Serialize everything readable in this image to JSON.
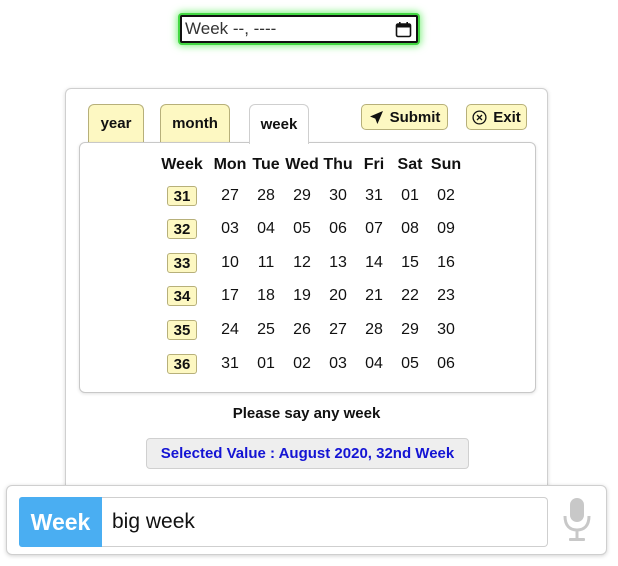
{
  "week_input": {
    "placeholder": "Week --, ----",
    "icon": "calendar-icon",
    "focus_color": "#43d843"
  },
  "tabs": [
    {
      "label": "year",
      "active": false
    },
    {
      "label": "month",
      "active": false
    },
    {
      "label": "week",
      "active": true
    }
  ],
  "actions": {
    "submit_label": "Submit",
    "exit_label": "Exit"
  },
  "calendar": {
    "headers": [
      "Week",
      "Mon",
      "Tue",
      "Wed",
      "Thu",
      "Fri",
      "Sat",
      "Sun"
    ],
    "rows": [
      {
        "week": "31",
        "days": [
          "27",
          "28",
          "29",
          "30",
          "31",
          "01",
          "02"
        ]
      },
      {
        "week": "32",
        "days": [
          "03",
          "04",
          "05",
          "06",
          "07",
          "08",
          "09"
        ]
      },
      {
        "week": "33",
        "days": [
          "10",
          "11",
          "12",
          "13",
          "14",
          "15",
          "16"
        ]
      },
      {
        "week": "34",
        "days": [
          "17",
          "18",
          "19",
          "20",
          "21",
          "22",
          "23"
        ]
      },
      {
        "week": "35",
        "days": [
          "24",
          "25",
          "26",
          "27",
          "28",
          "29",
          "30"
        ]
      },
      {
        "week": "36",
        "days": [
          "31",
          "01",
          "02",
          "03",
          "04",
          "05",
          "06"
        ]
      }
    ]
  },
  "prompt": "Please say any week",
  "selected_value": "Selected Value : August 2020, 32nd Week",
  "voice_bar": {
    "tag": "Week",
    "value": "big week",
    "mic_icon": "microphone-icon"
  },
  "colors": {
    "accent_yellow": "#fdf8c2",
    "tag_blue": "#4aaef2",
    "selected_text": "#1414d4"
  }
}
